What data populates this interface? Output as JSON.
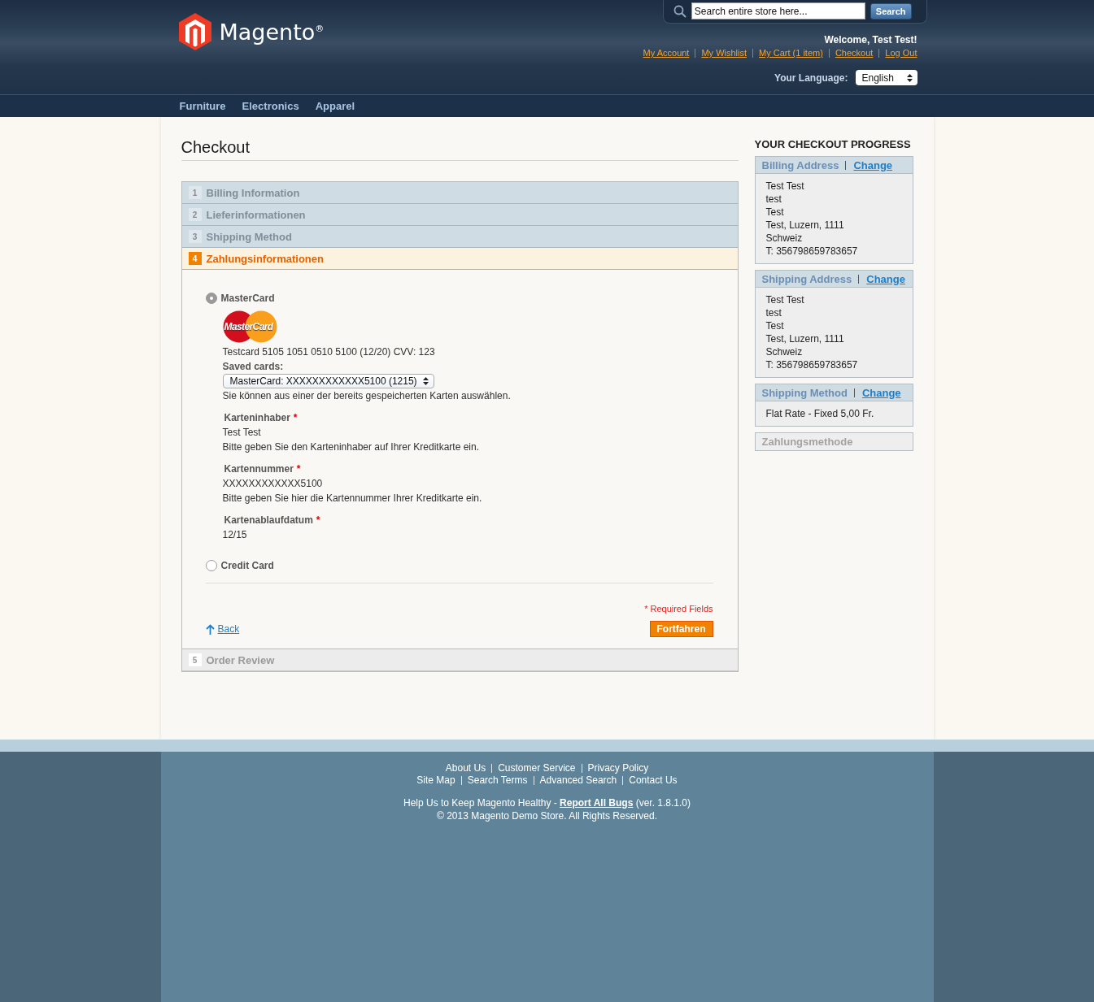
{
  "header": {
    "logo": {
      "name": "Magento",
      "mark": "®"
    },
    "search": {
      "placeholder": "Search entire store here...",
      "button": "Search"
    },
    "welcome": "Welcome, Test Test!",
    "links": [
      "My Account",
      "My Wishlist",
      "My Cart (1 item)",
      "Checkout",
      "Log Out"
    ],
    "language": {
      "label": "Your Language:",
      "value": "English"
    },
    "nav": [
      "Furniture",
      "Electronics",
      "Apparel"
    ]
  },
  "checkout": {
    "title": "Checkout",
    "steps": [
      {
        "number": "1",
        "title": "Billing Information",
        "completed": true,
        "selected": false
      },
      {
        "number": "2",
        "title": "Lieferinformationen",
        "completed": true,
        "selected": false
      },
      {
        "number": "3",
        "title": "Shipping Method",
        "completed": true,
        "selected": false
      },
      {
        "number": "4",
        "title": "Zahlungsinformationen",
        "completed": false,
        "selected": true
      },
      {
        "number": "5",
        "title": "Order Review",
        "completed": false,
        "selected": false
      }
    ],
    "payment_methods": [
      {
        "label": "MasterCard",
        "selected": true,
        "logo_text": "MasterCard",
        "note": "Testcard 5105 1051 0510 5100 (12/20) CVV: 123",
        "saved_cards": {
          "label": "Saved cards:",
          "value": "MasterCard: XXXXXXXXXXXX5100 (1215)",
          "hint": "Sie können aus einer der bereits gespeicherten Karten auswählen."
        },
        "fields": [
          {
            "label": "Karteninhaber",
            "required_mark": "*",
            "value": "Test Test",
            "hint": "Bitte geben Sie den Karteninhaber auf Ihrer Kreditkarte ein."
          },
          {
            "label": "Kartennummer",
            "required_mark": "*",
            "value": "XXXXXXXXXXXX5100",
            "hint": "Bitte geben Sie hier die Kartennummer Ihrer Kreditkarte ein."
          },
          {
            "label": "Kartenablaufdatum",
            "required_mark": "*",
            "value": "12/15"
          }
        ]
      },
      {
        "label": "Credit Card",
        "selected": false
      }
    ],
    "required_note": "* Required Fields",
    "back": "Back",
    "continue": "Fortfahren"
  },
  "progress": {
    "title": "YOUR CHECKOUT PROGRESS",
    "sections": [
      {
        "title": "Billing Address",
        "action": "Change",
        "lines": [
          "Test Test",
          "test",
          "Test",
          "Test, Luzern, 1111",
          "Schweiz",
          "T: 356798659783657"
        ]
      },
      {
        "title": "Shipping Address",
        "action": "Change",
        "lines": [
          "Test Test",
          "test",
          "Test",
          "Test, Luzern, 1111",
          "Schweiz",
          "T: 356798659783657"
        ]
      },
      {
        "title": "Shipping Method",
        "action": "Change",
        "lines": [
          "Flat Rate - Fixed 5,00 Fr."
        ]
      },
      {
        "title": "Zahlungsmethode"
      }
    ]
  },
  "footer": {
    "link_rows": [
      [
        "About Us",
        "Customer Service",
        "Privacy Policy"
      ],
      [
        "Site Map",
        "Search Terms",
        "Advanced Search",
        "Contact Us"
      ]
    ],
    "help": "Help Us to Keep Magento Healthy - ",
    "report_link": "Report All Bugs",
    "version": " (ver. 1.8.1.0)",
    "copyright": "© 2013 Magento Demo Store. All Rights Reserved."
  }
}
